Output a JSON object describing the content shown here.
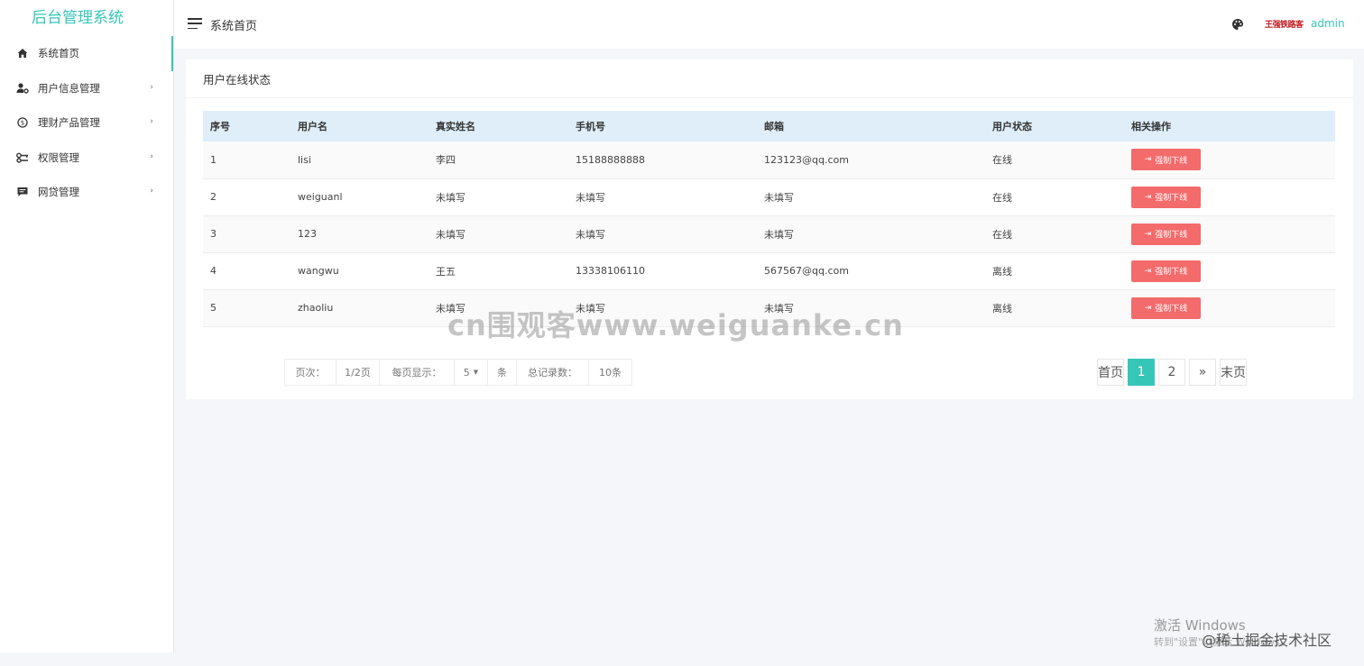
{
  "sidebar": {
    "logo": "后台管理系统",
    "items": [
      {
        "label": "系统首页",
        "icon": "home-icon",
        "has_caret": false
      },
      {
        "label": "用户信息管理",
        "icon": "user-gear-icon",
        "has_caret": true
      },
      {
        "label": "理财产品管理",
        "icon": "money-circle-icon",
        "has_caret": true
      },
      {
        "label": "权限管理",
        "icon": "key-icon",
        "has_caret": true
      },
      {
        "label": "网贷管理",
        "icon": "comment-icon",
        "has_caret": true
      }
    ],
    "caret": "›"
  },
  "header": {
    "title": "系统首页",
    "signature": "王强铁路客",
    "user": "admin"
  },
  "card": {
    "title": "用户在线状态",
    "columns": [
      "序号",
      "用户名",
      "真实姓名",
      "手机号",
      "邮箱",
      "用户状态",
      "相关操作"
    ],
    "rows": [
      {
        "id": "1",
        "username": "lisi",
        "realname": "李四",
        "phone": "15188888888",
        "email": "123123@qq.com",
        "status": "在线",
        "action": "强制下线"
      },
      {
        "id": "2",
        "username": "weiguanl",
        "realname": "未填写",
        "phone": "未填写",
        "email": "未填写",
        "status": "在线",
        "action": "强制下线"
      },
      {
        "id": "3",
        "username": "123",
        "realname": "未填写",
        "phone": "未填写",
        "email": "未填写",
        "status": "在线",
        "action": "强制下线"
      },
      {
        "id": "4",
        "username": "wangwu",
        "realname": "王五",
        "phone": "13338106110",
        "email": "567567@qq.com",
        "status": "离线",
        "action": "强制下线"
      },
      {
        "id": "5",
        "username": "zhaoliu",
        "realname": "未填写",
        "phone": "未填写",
        "email": "未填写",
        "status": "离线",
        "action": "强制下线"
      }
    ]
  },
  "page_info": {
    "page_label": "页次：",
    "page_value": "1/2页",
    "per_page_label": "每页显示：",
    "per_page_value": "5",
    "per_page_unit": "条",
    "total_label": "总记录数：",
    "total_value": "10条"
  },
  "pager": {
    "first": "首页",
    "pages": [
      "1",
      "2"
    ],
    "current": "1",
    "next": "»",
    "last": "末页"
  },
  "overlays": {
    "watermark": "cn围观客www.weiguanke.cn",
    "windows_activate": "激活 Windows",
    "windows_sub": "转到\"设置\"以激活 Windows。",
    "juejin": "@稀土掘金技术社区"
  },
  "colors": {
    "accent": "#36c6b8",
    "danger": "#f36b6b",
    "table_header": "#dfeef9"
  }
}
